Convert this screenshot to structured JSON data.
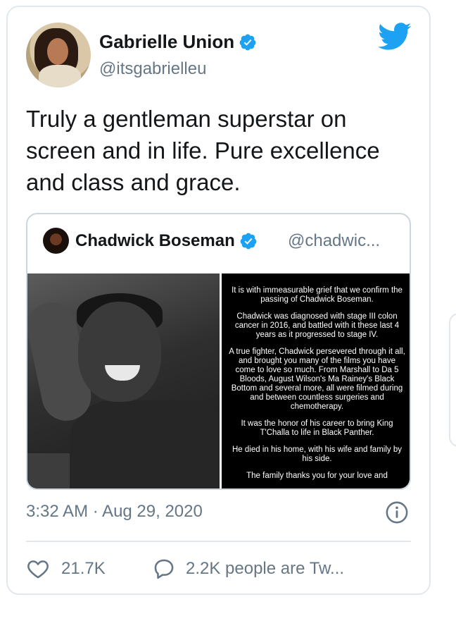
{
  "tweet": {
    "author_name": "Gabrielle Union",
    "author_handle": "@itsgabrielleu",
    "text": "Truly a gentleman superstar on screen and in life. Pure excellence and class and grace.",
    "timestamp": "3:32 AM · Aug 29, 2020",
    "likes": "21.7K",
    "replies_label": "2.2K people are Tw..."
  },
  "quoted_tweet": {
    "author_name": "Chadwick Boseman",
    "author_handle": "@chadwic...",
    "statement": [
      "It is with immeasurable grief that we confirm the passing of Chadwick Boseman.",
      "Chadwick was diagnosed with stage III colon cancer in 2016, and battled with it these last 4 years as it progressed to stage IV.",
      "A true fighter, Chadwick persevered through it all, and brought you many of the films you have come to love so much. From Marshall to Da 5 Bloods, August Wilson's Ma Rainey's Black Bottom and several more, all were filmed during and between countless surgeries and chemotherapy.",
      "It was the honor of his career to bring King T'Challa to life in Black Panther.",
      "He died in his home, with his wife and family by his side.",
      "The family thanks you for your love and"
    ]
  },
  "icons": {
    "verified": "verified-badge-icon",
    "brand": "twitter-bird-icon",
    "info": "info-icon",
    "like": "heart-icon",
    "reply": "speech-bubble-icon"
  },
  "colors": {
    "brand": "#1da1f2",
    "secondary_text": "#657786",
    "border": "#e1e8ed"
  }
}
